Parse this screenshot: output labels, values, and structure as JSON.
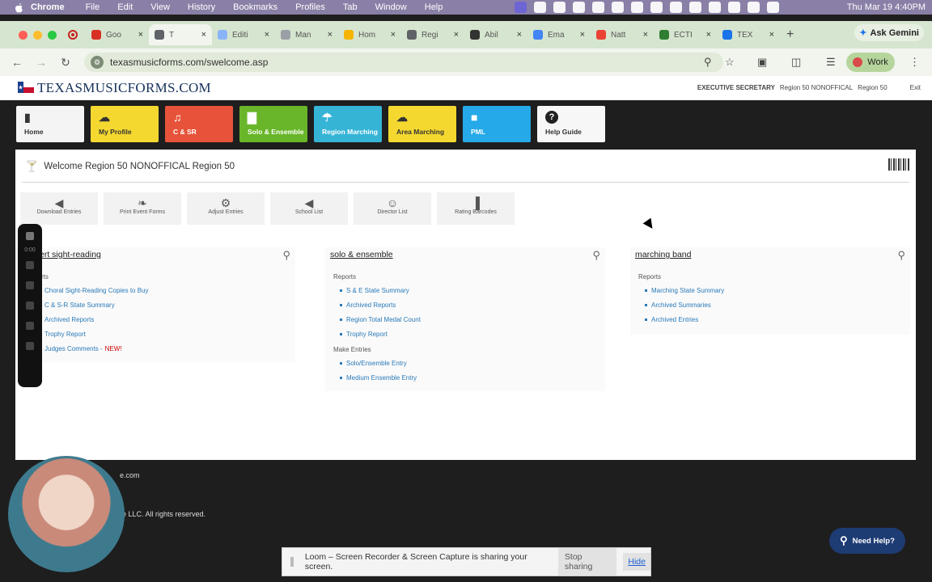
{
  "mac_menubar": {
    "app_name": "Chrome",
    "menus": [
      "File",
      "Edit",
      "View",
      "History",
      "Bookmarks",
      "Profiles",
      "Tab",
      "Window",
      "Help"
    ],
    "clock": "Thu Mar 19  4:40PM"
  },
  "browser": {
    "tabs": [
      {
        "label": "Goo",
        "icon": "gmail-icon",
        "color": "#d93025"
      },
      {
        "label": "T",
        "icon": "loading-icon",
        "color": "#5f6368",
        "active": true
      },
      {
        "label": "Editi",
        "icon": "document-icon",
        "color": "#8ab4f8"
      },
      {
        "label": "Man",
        "icon": "document-icon",
        "color": "#9aa0a6"
      },
      {
        "label": "Hom",
        "icon": "drive-icon",
        "color": "#f4b400"
      },
      {
        "label": "Regi",
        "icon": "web-icon",
        "color": "#5f6368"
      },
      {
        "label": "Abil",
        "icon": "person-icon",
        "color": "#333333"
      },
      {
        "label": "Ema",
        "icon": "document-icon",
        "color": "#4285f4"
      },
      {
        "label": "Natt",
        "icon": "music-icon",
        "color": "#ea4335"
      },
      {
        "label": "ECTI",
        "icon": "web-icon",
        "color": "#2e7d32"
      },
      {
        "label": "TEX",
        "icon": "web-icon",
        "color": "#1a73e8"
      }
    ],
    "gemini_label": "Ask Gemini",
    "url": "texasmusicforms.com/swelcome.asp",
    "profile_label": "Work"
  },
  "site": {
    "logo": "TEXASMUSICFORMS.COM",
    "user_role": "EXECUTIVE SECRETARY",
    "user_org": "Region 50 NONOFFICAL",
    "user_region": "Region 50",
    "exit_label": "Exit",
    "nav": [
      {
        "label": "Home",
        "icon": "bookmark-icon",
        "bg": "#f4f4f4",
        "fg": "#333333"
      },
      {
        "label": "My Profile",
        "icon": "cloud-icon",
        "bg": "#f4d82f",
        "fg": "#333333"
      },
      {
        "label": "C & SR",
        "icon": "music-icon",
        "bg": "#e7533a",
        "fg": "#ffffff"
      },
      {
        "label": "Solo & Ensemble",
        "icon": "bar-chart-icon",
        "bg": "#69b62a",
        "fg": "#ffffff"
      },
      {
        "label": "Region Marching",
        "icon": "umbrella-icon",
        "bg": "#36b4d6",
        "fg": "#ffffff"
      },
      {
        "label": "Area Marching",
        "icon": "cloud-icon",
        "bg": "#f4d82f",
        "fg": "#333333"
      },
      {
        "label": "PML",
        "icon": "book-icon",
        "bg": "#25a9e8",
        "fg": "#ffffff"
      },
      {
        "label": "Help Guide",
        "icon": "help-icon",
        "bg": "#f7f7f7",
        "fg": "#333333"
      }
    ],
    "welcome": "Welcome Region 50 NONOFFICAL Region 50",
    "tools": [
      {
        "label": "Download Entries",
        "icon": "megaphone-icon"
      },
      {
        "label": "Print Event Forms",
        "icon": "leaf-icon"
      },
      {
        "label": "Adjust Entries",
        "icon": "gear-icon"
      },
      {
        "label": "School List",
        "icon": "megaphone-icon"
      },
      {
        "label": "Director List",
        "icon": "users-icon"
      },
      {
        "label": "Rating Barcodes",
        "icon": "barcode-icon"
      }
    ],
    "columns": [
      {
        "title": "ert sight-reading",
        "sections": [
          {
            "label": "rts",
            "links": [
              "Choral Sight-Reading Copies to Buy",
              "C & S-R State Summary",
              "Archived Reports",
              "Trophy Report",
              "Judges Comments - "
            ]
          }
        ],
        "new_badge": "NEW!"
      },
      {
        "title": "solo & ensemble",
        "sections": [
          {
            "label": "Reports",
            "links": [
              "S & E State Summary",
              "Archived Reports",
              "Region Total Medal Count",
              "Trophy Report"
            ]
          },
          {
            "label": "Make Entries",
            "links": [
              "Solo/Ensemble Entry",
              "Medium Ensemble Entry"
            ]
          }
        ]
      },
      {
        "title": "marching band",
        "sections": [
          {
            "label": "Reports",
            "links": [
              "Marching State Summary",
              "Archived Summaries",
              "Archived Entries"
            ]
          }
        ]
      }
    ],
    "footer": {
      "domain_frag": "e.com",
      "copyright_frag": "e LLC. All rights reserved."
    },
    "need_help": "Need Help?"
  },
  "loom": {
    "timer": "0:00",
    "message": "Loom – Screen Recorder & Screen Capture is sharing your screen.",
    "stop_label": "Stop sharing",
    "hide_label": "Hide"
  }
}
